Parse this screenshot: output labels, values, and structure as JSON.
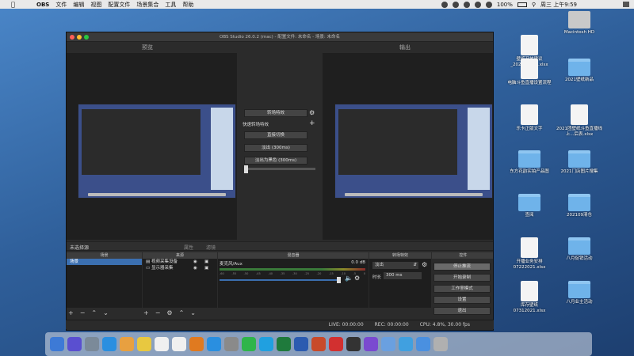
{
  "menubar": {
    "app": "OBS",
    "items": [
      "文件",
      "编辑",
      "视图",
      "配置文件",
      "场景集合",
      "工具",
      "帮助"
    ],
    "battery": "100%",
    "datetime": "周三 上午9:59"
  },
  "desktop": {
    "icons": [
      {
        "label": "Macintosh HD",
        "type": "hd"
      },
      {
        "label": "壁纸开放建议\n_2021-07-15.xlsx",
        "type": "doc"
      },
      {
        "label": "电脑斗鱼直播设置流程",
        "type": "doc"
      },
      {
        "label": "2021壁纸新品",
        "type": "folder"
      },
      {
        "label": "乐卡正版文字",
        "type": "doc"
      },
      {
        "label": "2021团壁纸斗鱼直播线上...后表.xlsx",
        "type": "doc"
      },
      {
        "label": "东方花韵实拍产品图",
        "type": "folder"
      },
      {
        "label": "2021门店图片搜集",
        "type": "folder"
      },
      {
        "label": "查阅",
        "type": "folder"
      },
      {
        "label": "202109清仓",
        "type": "folder"
      },
      {
        "label": "开播业务安排\n07222021.xlsx",
        "type": "doc"
      },
      {
        "label": "八月促销活动",
        "type": "folder"
      },
      {
        "label": "库存壁纸\n07312021.xlsx",
        "type": "doc"
      },
      {
        "label": "八月业主活动",
        "type": "folder"
      }
    ]
  },
  "window": {
    "title": "OBS Studio 26.0.2 (mac) - 配置文件: 未命名 - 场景: 未命名"
  },
  "preview": {
    "label": "预览"
  },
  "program": {
    "label": "输出"
  },
  "transition": {
    "button": "转场特效",
    "quick_label": "快速转场特效",
    "items": [
      "直接切换",
      "淡出 (300ms)",
      "淡出为黑色 (300ms)"
    ]
  },
  "source_bar": {
    "text": "未选择源",
    "props": "属性",
    "filters": "滤镜"
  },
  "docks": {
    "scenes": "场景",
    "sources": "来源",
    "mixer": "混音器",
    "transitions": "转场特效",
    "controls": "控件"
  },
  "scenes": [
    "场景"
  ],
  "sources": [
    {
      "icon": "camera-icon",
      "label": "视频采集设备"
    },
    {
      "icon": "monitor-icon",
      "label": "显示器采集"
    }
  ],
  "mixer": {
    "track": "麦克风/Aux",
    "level": "0.0 dB",
    "ticks": [
      "-60",
      "-55",
      "-50",
      "-45",
      "-40",
      "-35",
      "-30",
      "-25",
      "-20",
      "-15",
      "-10",
      "-5",
      "0"
    ]
  },
  "trans_dock": {
    "value": "淡出",
    "duration_label": "时长",
    "duration": "300 ms"
  },
  "controls": [
    "停止推流",
    "开始录制",
    "工作室模式",
    "设置",
    "退出"
  ],
  "status": {
    "live": "LIVE: 00:00:00",
    "rec": "REC: 00:00:00",
    "cpu": "CPU: 4.8%, 30.00 fps"
  },
  "dock_apps": [
    "Finder",
    "Siri",
    "Launchpad",
    "Safari",
    "Photos",
    "Notes",
    "Calendar",
    "Reminders",
    "Books",
    "App Store",
    "Settings",
    "WeChat",
    "QQ",
    "Excel",
    "Word",
    "PowerPoint",
    "NetEase",
    "OBS",
    "Feedback",
    "Preview",
    "QuickTime",
    "Downloads",
    "Trash"
  ],
  "colors": {
    "accent": "#3b6fb0",
    "dock_bg": "#e0e4ec"
  }
}
